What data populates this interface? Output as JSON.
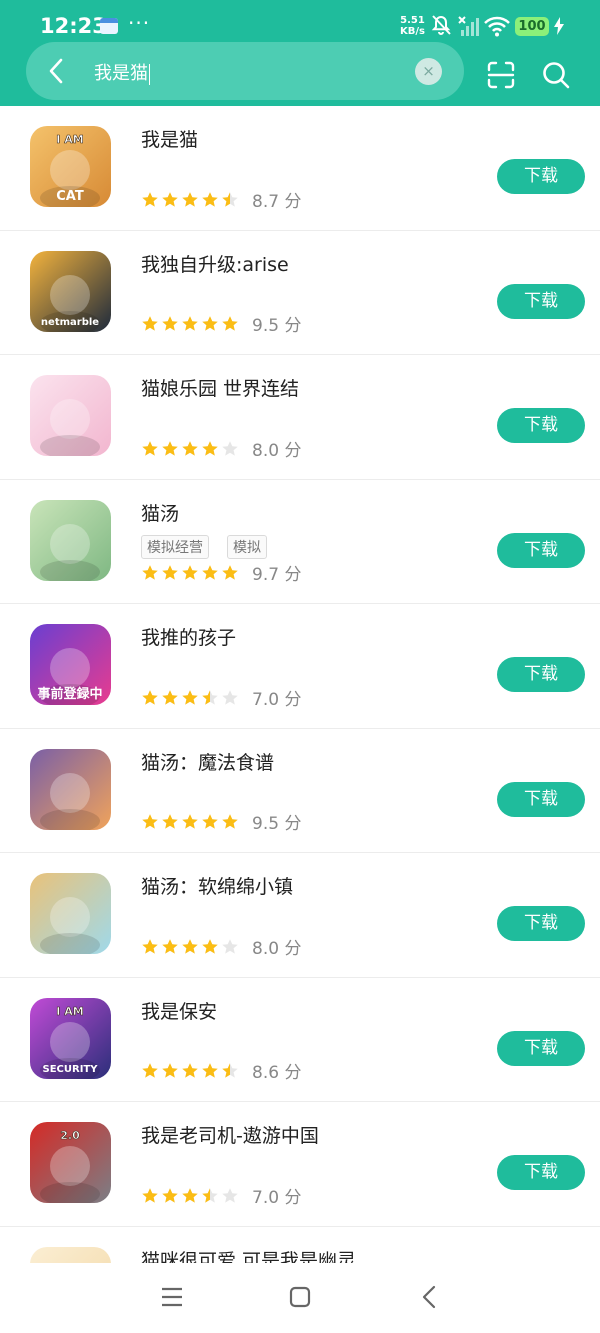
{
  "status_bar": {
    "time": "12:23",
    "dots": "···",
    "net_speed_value": "5.51",
    "net_speed_unit": "KB/s",
    "battery": "100"
  },
  "search": {
    "query": "我是猫",
    "clear_label": "×"
  },
  "results": [
    {
      "name": "我是猫",
      "rating": 4.5,
      "score": "8.7 分",
      "tags": [],
      "button": "下载",
      "icon": "cat-game-icon",
      "icon_colors": [
        "#d78a35",
        "#f4c26b"
      ],
      "icon_text": [
        "I AM",
        "CAT"
      ]
    },
    {
      "name": "我独自升级:arise",
      "rating": 5,
      "score": "9.5 分",
      "tags": [],
      "button": "下载",
      "icon": "anime-warrior-icon",
      "icon_colors": [
        "#1e2a3c",
        "#f3b33d"
      ],
      "icon_text": [
        "",
        "netmarble"
      ]
    },
    {
      "name": "猫娘乐园 世界连结",
      "rating": 4,
      "score": "8.0 分",
      "tags": [],
      "button": "下载",
      "icon": "catgirl-icon",
      "icon_colors": [
        "#f2b6cf",
        "#fbe3ee"
      ],
      "icon_text": [
        "",
        ""
      ]
    },
    {
      "name": "猫汤",
      "rating": 5,
      "score": "9.7 分",
      "tags": [
        "模拟经营",
        "模拟"
      ],
      "button": "下载",
      "icon": "frog-hood-cat-icon",
      "icon_colors": [
        "#7fb883",
        "#c9e4b9"
      ],
      "icon_text": [
        "",
        ""
      ]
    },
    {
      "name": "我推的孩子",
      "rating": 3.5,
      "score": "7.0 分",
      "tags": [],
      "button": "下载",
      "icon": "idol-girl-icon",
      "icon_colors": [
        "#e83c8f",
        "#6a3fd1"
      ],
      "icon_text": [
        "",
        "事前登録中"
      ]
    },
    {
      "name": "猫汤：魔法食谱",
      "rating": 5,
      "score": "9.5 分",
      "tags": [],
      "button": "下载",
      "icon": "wizard-cat-icon",
      "icon_colors": [
        "#f0a35b",
        "#7a5fa6"
      ],
      "icon_text": [
        "",
        ""
      ]
    },
    {
      "name": "猫汤：软绵绵小镇",
      "rating": 4,
      "score": "8.0 分",
      "tags": [],
      "button": "下载",
      "icon": "straw-hat-cat-icon",
      "icon_colors": [
        "#9fd9ea",
        "#e9c27a"
      ],
      "icon_text": [
        "",
        ""
      ]
    },
    {
      "name": "我是保安",
      "rating": 4.5,
      "score": "8.6 分",
      "tags": [],
      "button": "下载",
      "icon": "security-guard-icon",
      "icon_colors": [
        "#2b2f7a",
        "#c14bd6"
      ],
      "icon_text": [
        "I AM",
        "SECURITY"
      ]
    },
    {
      "name": "我是老司机-遨游中国",
      "rating": 3.5,
      "score": "7.0 分",
      "tags": [],
      "button": "下载",
      "icon": "red-truck-icon",
      "icon_colors": [
        "#7b7f86",
        "#d52a26"
      ],
      "icon_text": [
        "2.0",
        ""
      ]
    },
    {
      "name": "猫咪很可爱 可是我是幽灵",
      "rating": 0,
      "score": "",
      "tags": [],
      "button": "",
      "icon": "ghost-cat-icon",
      "icon_colors": [
        "#f3d9a8",
        "#fbeed3"
      ],
      "icon_text": [
        "",
        ""
      ]
    }
  ],
  "colors": {
    "accent": "#1fbc9c",
    "star": "#fbbd14",
    "star_empty": "#e6e6e6"
  }
}
